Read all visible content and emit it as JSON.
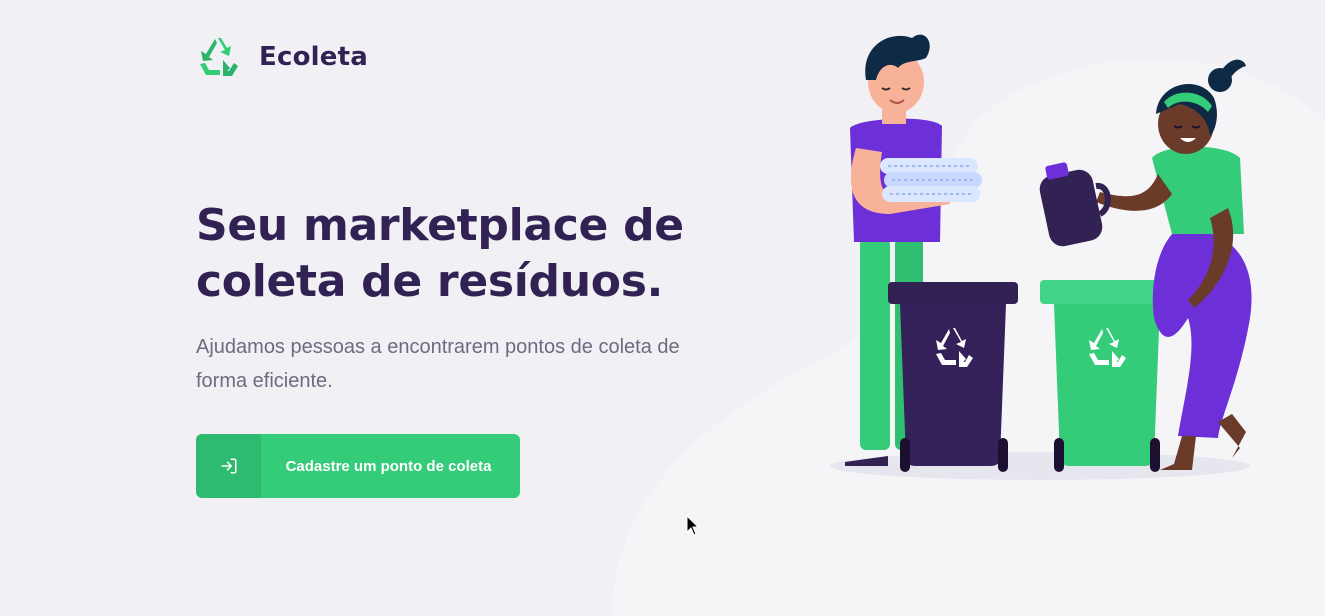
{
  "app": {
    "name": "Ecoleta"
  },
  "hero": {
    "title": "Seu marketplace de coleta de resíduos.",
    "subtitle": "Ajudamos pessoas a encontrarem pontos de coleta de forma eficiente."
  },
  "cta": {
    "label": "Cadastre um ponto de coleta",
    "icon": "log-in-icon"
  },
  "colors": {
    "brand_dark": "#322153",
    "brand_green": "#34cb79",
    "accent_purple": "#6c2fd8",
    "background": "#f0f0f5",
    "text_muted": "#6c6c80"
  }
}
